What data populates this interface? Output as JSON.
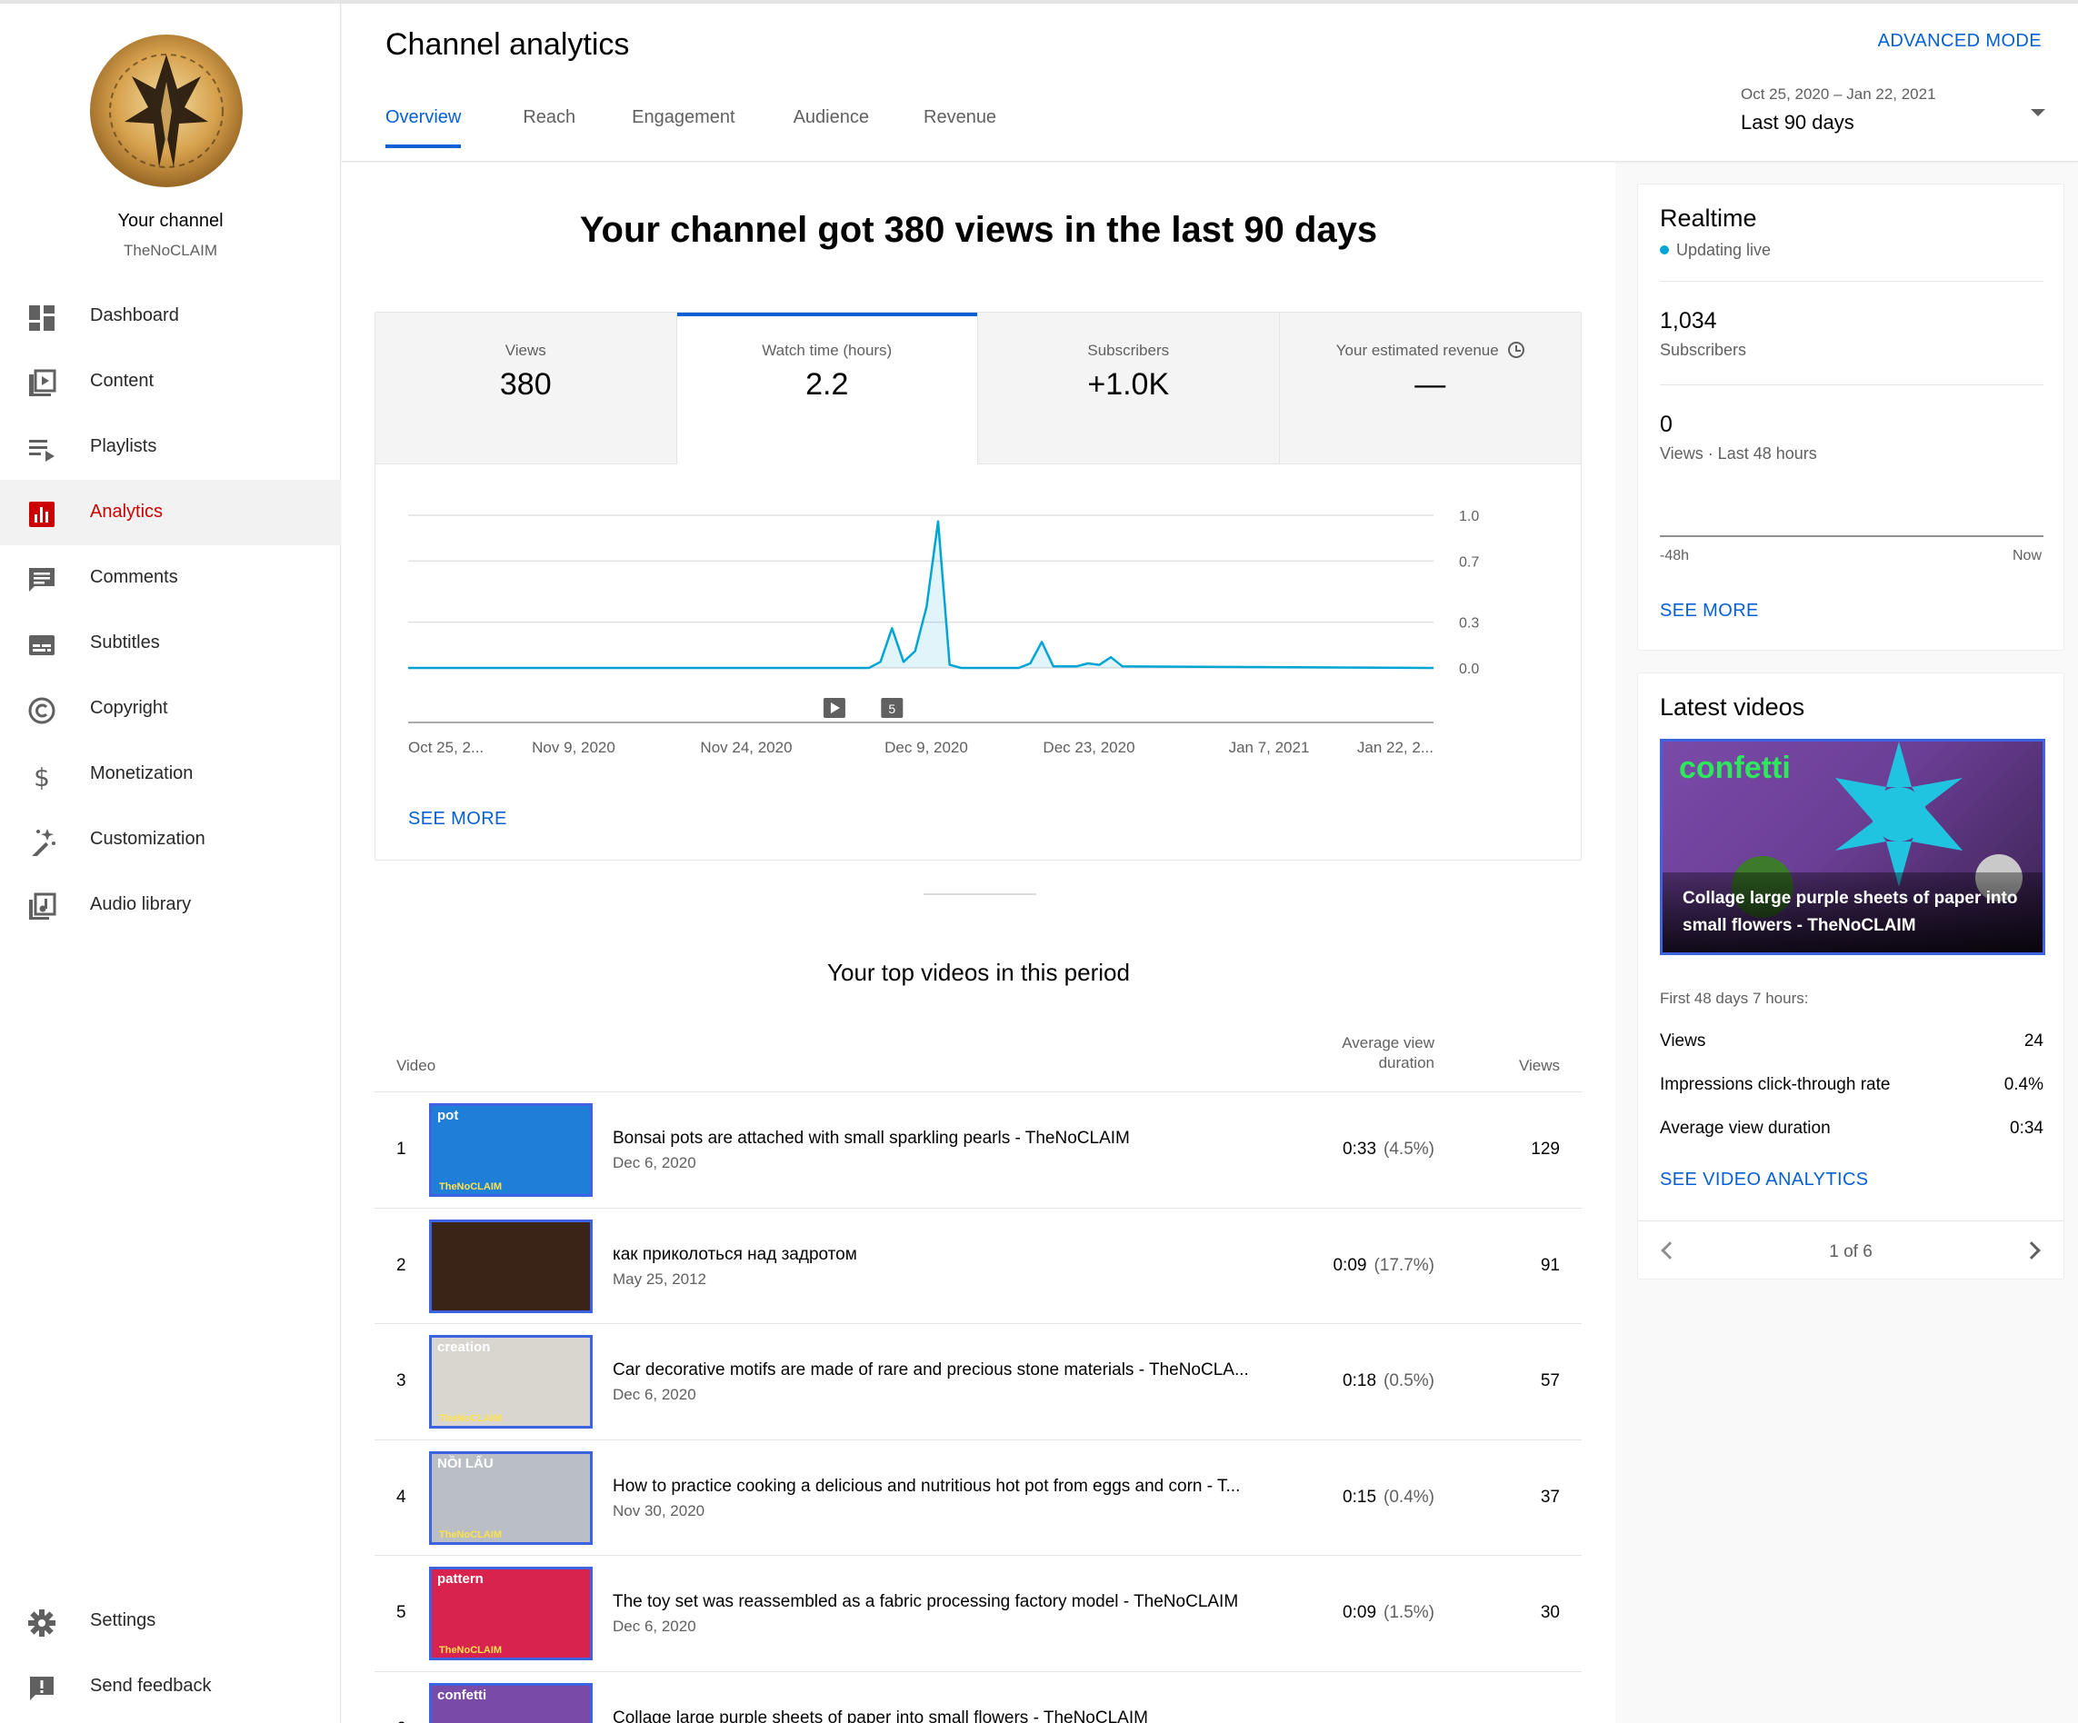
{
  "sidebar": {
    "channel_title": "Your channel",
    "channel_handle": "TheNoCLAIM",
    "items": [
      {
        "label": "Dashboard",
        "icon": "dashboard-icon"
      },
      {
        "label": "Content",
        "icon": "content-icon"
      },
      {
        "label": "Playlists",
        "icon": "playlists-icon"
      },
      {
        "label": "Analytics",
        "icon": "analytics-icon",
        "active": true
      },
      {
        "label": "Comments",
        "icon": "comments-icon"
      },
      {
        "label": "Subtitles",
        "icon": "subtitles-icon"
      },
      {
        "label": "Copyright",
        "icon": "copyright-icon"
      },
      {
        "label": "Monetization",
        "icon": "dollar-icon"
      },
      {
        "label": "Customization",
        "icon": "magic-wand-icon"
      },
      {
        "label": "Audio library",
        "icon": "audio-library-icon"
      }
    ],
    "bottom_items": [
      {
        "label": "Settings",
        "icon": "gear-icon"
      },
      {
        "label": "Send feedback",
        "icon": "feedback-icon"
      }
    ]
  },
  "header": {
    "title": "Channel analytics",
    "advanced_mode": "ADVANCED MODE",
    "tabs": [
      {
        "label": "Overview",
        "active": true
      },
      {
        "label": "Reach"
      },
      {
        "label": "Engagement"
      },
      {
        "label": "Audience"
      },
      {
        "label": "Revenue"
      }
    ],
    "date_range": {
      "dates": "Oct 25, 2020 – Jan 22, 2021",
      "label": "Last 90 days"
    }
  },
  "main": {
    "headline": "Your channel got 380 views in the last 90 days",
    "metrics": [
      {
        "label": "Views",
        "value": "380"
      },
      {
        "label": "Watch time (hours)",
        "value": "2.2",
        "active": true
      },
      {
        "label": "Subscribers",
        "value": "+1.0K"
      },
      {
        "label": "Your estimated revenue",
        "value": "—"
      }
    ],
    "see_more": "SEE MORE",
    "top_videos_title": "Your top videos in this period",
    "table_headers": {
      "video": "Video",
      "avd_line1": "Average view",
      "avd_line2": "duration",
      "views": "Views"
    },
    "top_videos": [
      {
        "rank": "1",
        "title": "Bonsai pots are attached with small sparkling pearls - TheNoCLAIM",
        "date": "Dec 6, 2020",
        "avd": "0:33",
        "pct": "(4.5%)",
        "views": "129",
        "thumb_label": "pot",
        "thumb_bg": "#1f7fd8"
      },
      {
        "rank": "2",
        "title": "как приколоться над задротом",
        "date": "May 25, 2012",
        "avd": "0:09",
        "pct": "(17.7%)",
        "views": "91",
        "thumb_label": "",
        "thumb_bg": "#3a2418"
      },
      {
        "rank": "3",
        "title": "Car decorative motifs are made of rare and precious stone materials - TheNoCLA...",
        "date": "Dec 6, 2020",
        "avd": "0:18",
        "pct": "(0.5%)",
        "views": "57",
        "thumb_label": "creation",
        "thumb_bg": "#d9d6cf"
      },
      {
        "rank": "4",
        "title": "How to practice cooking a delicious and nutritious hot pot from eggs and corn - T...",
        "date": "Nov 30, 2020",
        "avd": "0:15",
        "pct": "(0.4%)",
        "views": "37",
        "thumb_label": "NỒI LẨU",
        "thumb_bg": "#b9bfc4"
      },
      {
        "rank": "5",
        "title": "The toy set was reassembled as a fabric processing factory model - TheNoCLAIM",
        "date": "Dec 6, 2020",
        "avd": "0:09",
        "pct": "(1.5%)",
        "views": "30",
        "thumb_label": "pattern",
        "thumb_bg": "#d8234e"
      },
      {
        "rank": "6",
        "title": "Collage large purple sheets of paper into small flowers - TheNoCLAIM",
        "date": "",
        "avd": "",
        "pct": "",
        "views": "",
        "thumb_label": "confetti",
        "thumb_bg": "#7a4aa8"
      }
    ],
    "thumb_brand": "TheNoCLAIM"
  },
  "chart_data": {
    "type": "line",
    "title": "",
    "xlabel": "",
    "ylabel": "",
    "x_ticks": [
      "Oct 25, 2...",
      "Nov 9, 2020",
      "Nov 24, 2020",
      "Dec 9, 2020",
      "Dec 23, 2020",
      "Jan 7, 2021",
      "Jan 22, 2..."
    ],
    "y_ticks": [
      "1.0",
      "0.7",
      "0.3",
      "0.0"
    ],
    "ylim": [
      0,
      1.0
    ],
    "x_range": [
      "Oct 25, 2020",
      "Jan 22, 2021"
    ],
    "series": [
      {
        "values": [
          {
            "x": "Oct 25, 2020",
            "y": 0
          },
          {
            "x": "Dec 4, 2020",
            "y": 0
          },
          {
            "x": "Dec 5, 2020",
            "y": 0.04
          },
          {
            "x": "Dec 6, 2020",
            "y": 0.26
          },
          {
            "x": "Dec 7, 2020",
            "y": 0.04
          },
          {
            "x": "Dec 8, 2020",
            "y": 0.11
          },
          {
            "x": "Dec 9, 2020",
            "y": 0.4
          },
          {
            "x": "Dec 10, 2020",
            "y": 0.96
          },
          {
            "x": "Dec 11, 2020",
            "y": 0.02
          },
          {
            "x": "Dec 12, 2020",
            "y": 0
          },
          {
            "x": "Dec 17, 2020",
            "y": 0
          },
          {
            "x": "Dec 18, 2020",
            "y": 0.03
          },
          {
            "x": "Dec 19, 2020",
            "y": 0.17
          },
          {
            "x": "Dec 20, 2020",
            "y": 0.01
          },
          {
            "x": "Dec 22, 2020",
            "y": 0.01
          },
          {
            "x": "Dec 23, 2020",
            "y": 0.03
          },
          {
            "x": "Dec 24, 2020",
            "y": 0.02
          },
          {
            "x": "Dec 25, 2020",
            "y": 0.07
          },
          {
            "x": "Dec 26, 2020",
            "y": 0.01
          },
          {
            "x": "Jan 22, 2021",
            "y": 0
          }
        ]
      }
    ],
    "markers": [
      {
        "x": "Dec 1, 2020",
        "kind": "play",
        "label": ""
      },
      {
        "x": "Dec 6, 2020",
        "kind": "count",
        "label": "5"
      }
    ],
    "color": "#00a5d4",
    "grid": true
  },
  "realtime": {
    "title": "Realtime",
    "status": "Updating live",
    "subscribers_value": "1,034",
    "subscribers_label": "Subscribers",
    "views_value": "0",
    "views_label": "Views · Last 48 hours",
    "axis_left": "-48h",
    "axis_right": "Now",
    "see_more": "SEE MORE"
  },
  "latest": {
    "title": "Latest videos",
    "thumb_word": "confetti",
    "video_title": "Collage large purple sheets of paper into small flowers - TheNoCLAIM",
    "period": "First 48 days 7 hours:",
    "stats": [
      {
        "label": "Views",
        "value": "24"
      },
      {
        "label": "Impressions click-through rate",
        "value": "0.4%"
      },
      {
        "label": "Average view duration",
        "value": "0:34"
      }
    ],
    "see_analytics": "SEE VIDEO ANALYTICS",
    "pager": "1 of 6"
  },
  "colors": {
    "accent": "#065fd4",
    "active_nav": "#cc0000",
    "chart_line": "#00a5d4"
  }
}
